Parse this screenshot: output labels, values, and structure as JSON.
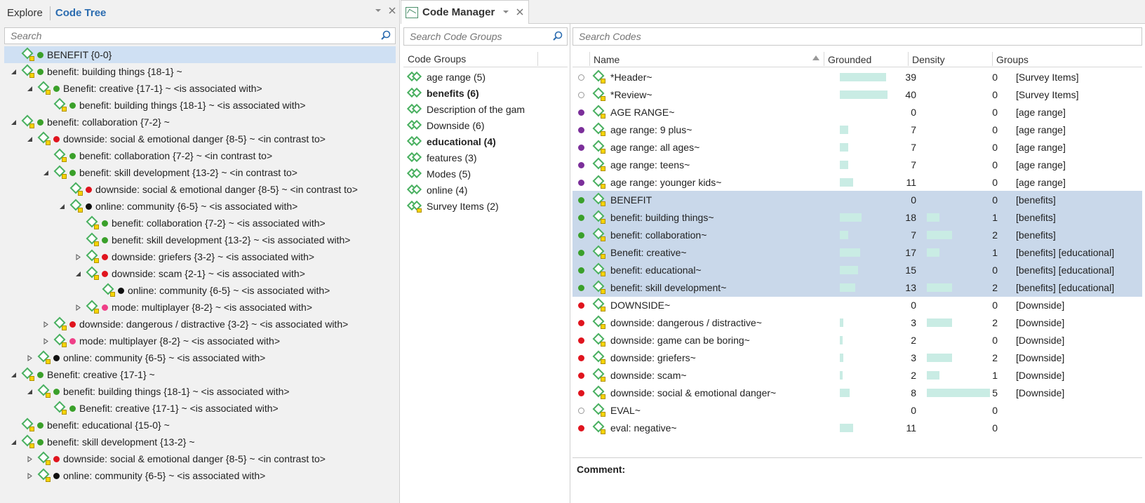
{
  "left_panel": {
    "tab_explore": "Explore",
    "tab_code_tree": "Code Tree",
    "search_placeholder": "Search",
    "tree": [
      {
        "label": "BENEFIT {0-0}",
        "dot": "green",
        "twisty": "",
        "indent": 0,
        "selected": true
      },
      {
        "label": "benefit: building things {18-1} ~",
        "dot": "green",
        "twisty": "open",
        "indent": 0
      },
      {
        "label": "Benefit: creative {17-1} ~ <is associated with>",
        "dot": "green",
        "twisty": "open",
        "indent": 1
      },
      {
        "label": "benefit: building things {18-1} ~ <is associated with>",
        "dot": "green",
        "twisty": "",
        "indent": 2
      },
      {
        "label": "benefit: collaboration {7-2} ~",
        "dot": "green",
        "twisty": "open",
        "indent": 0
      },
      {
        "label": "downside: social & emotional danger {8-5} ~ <in contrast to>",
        "dot": "red",
        "twisty": "open",
        "indent": 1
      },
      {
        "label": "benefit: collaboration {7-2} ~ <in contrast to>",
        "dot": "green",
        "twisty": "",
        "indent": 2
      },
      {
        "label": "benefit: skill development {13-2} ~ <in contrast to>",
        "dot": "green",
        "twisty": "open",
        "indent": 2
      },
      {
        "label": "downside: social & emotional danger {8-5} ~ <in contrast to>",
        "dot": "red",
        "twisty": "",
        "indent": 3
      },
      {
        "label": "online: community {6-5} ~ <is associated with>",
        "dot": "black",
        "twisty": "open",
        "indent": 3
      },
      {
        "label": "benefit: collaboration {7-2} ~ <is associated with>",
        "dot": "green",
        "twisty": "",
        "indent": 4
      },
      {
        "label": "benefit: skill development {13-2} ~ <is associated with>",
        "dot": "green",
        "twisty": "",
        "indent": 4
      },
      {
        "label": "downside: griefers {3-2} ~ <is associated with>",
        "dot": "red",
        "twisty": "closed",
        "indent": 4
      },
      {
        "label": "downside: scam {2-1} ~ <is associated with>",
        "dot": "red",
        "twisty": "open",
        "indent": 4
      },
      {
        "label": "online: community {6-5} ~ <is associated with>",
        "dot": "black",
        "twisty": "",
        "indent": 5
      },
      {
        "label": "mode: multiplayer {8-2} ~ <is associated with>",
        "dot": "pink",
        "twisty": "closed",
        "indent": 4
      },
      {
        "label": "downside: dangerous / distractive {3-2} ~ <is associated with>",
        "dot": "red",
        "twisty": "closed",
        "indent": 2
      },
      {
        "label": "mode: multiplayer {8-2} ~ <is associated with>",
        "dot": "pink",
        "twisty": "closed",
        "indent": 2
      },
      {
        "label": "online: community {6-5} ~ <is associated with>",
        "dot": "black",
        "twisty": "closed",
        "indent": 1
      },
      {
        "label": "Benefit: creative {17-1} ~",
        "dot": "green",
        "twisty": "open",
        "indent": 0
      },
      {
        "label": "benefit: building things {18-1} ~ <is associated with>",
        "dot": "green",
        "twisty": "open",
        "indent": 1
      },
      {
        "label": "Benefit: creative {17-1} ~ <is associated with>",
        "dot": "green",
        "twisty": "",
        "indent": 2
      },
      {
        "label": "benefit: educational {15-0} ~",
        "dot": "green",
        "twisty": "",
        "indent": 0
      },
      {
        "label": "benefit: skill development {13-2} ~",
        "dot": "green",
        "twisty": "open",
        "indent": 0
      },
      {
        "label": "downside: social & emotional danger {8-5} ~ <in contrast to>",
        "dot": "red",
        "twisty": "closed",
        "indent": 1
      },
      {
        "label": "online: community {6-5} ~ <is associated with>",
        "dot": "black",
        "twisty": "closed",
        "indent": 1
      }
    ]
  },
  "code_manager": {
    "title": "Code Manager",
    "groups_search_placeholder": "Search Code Groups",
    "codes_search_placeholder": "Search Codes",
    "groups_header": "Code Groups",
    "groups": [
      {
        "label": "age range (5)",
        "bold": false
      },
      {
        "label": "benefits (6)",
        "bold": true
      },
      {
        "label": "Description of the gam",
        "bold": false
      },
      {
        "label": "Downside (6)",
        "bold": false
      },
      {
        "label": "educational (4)",
        "bold": true
      },
      {
        "label": "features (3)",
        "bold": false
      },
      {
        "label": "Modes (5)",
        "bold": false
      },
      {
        "label": "online (4)",
        "bold": false
      },
      {
        "label": "Survey Items (2)",
        "bold": false
      }
    ],
    "columns": {
      "name": "Name",
      "grounded": "Grounded",
      "density": "Density",
      "groups": "Groups"
    },
    "colors": {
      "green": "#3aa02a",
      "red": "#e0141e",
      "purple": "#7b2f9a",
      "bar": "#c9ece4",
      "selected": "#c9d8ea"
    },
    "codes": [
      {
        "dot": "empty",
        "name": "*Header~",
        "grounded": 39,
        "density": 0,
        "groups": "[Survey Items]",
        "selected": false
      },
      {
        "dot": "empty",
        "name": "*Review~",
        "grounded": 40,
        "density": 0,
        "groups": "[Survey Items]",
        "selected": false
      },
      {
        "dot": "purple",
        "name": "AGE RANGE~",
        "grounded": 0,
        "density": 0,
        "groups": "[age range]",
        "selected": false
      },
      {
        "dot": "purple",
        "name": "age range: 9 plus~",
        "grounded": 7,
        "density": 0,
        "groups": "[age range]",
        "selected": false
      },
      {
        "dot": "purple",
        "name": "age range: all ages~",
        "grounded": 7,
        "density": 0,
        "groups": "[age range]",
        "selected": false
      },
      {
        "dot": "purple",
        "name": "age range: teens~",
        "grounded": 7,
        "density": 0,
        "groups": "[age range]",
        "selected": false
      },
      {
        "dot": "purple",
        "name": "age range: younger kids~",
        "grounded": 11,
        "density": 0,
        "groups": "[age range]",
        "selected": false
      },
      {
        "dot": "green",
        "name": "BENEFIT",
        "grounded": 0,
        "density": 0,
        "groups": "[benefits]",
        "selected": true
      },
      {
        "dot": "green",
        "name": "benefit: building things~",
        "grounded": 18,
        "density": 1,
        "groups": "[benefits]",
        "selected": true
      },
      {
        "dot": "green",
        "name": "benefit: collaboration~",
        "grounded": 7,
        "density": 2,
        "groups": "[benefits]",
        "selected": true
      },
      {
        "dot": "green",
        "name": "Benefit: creative~",
        "grounded": 17,
        "density": 1,
        "groups": "[benefits] [educational]",
        "selected": true
      },
      {
        "dot": "green",
        "name": "benefit: educational~",
        "grounded": 15,
        "density": 0,
        "groups": "[benefits] [educational]",
        "selected": true
      },
      {
        "dot": "green",
        "name": "benefit: skill development~",
        "grounded": 13,
        "density": 2,
        "groups": "[benefits] [educational]",
        "selected": true
      },
      {
        "dot": "red",
        "name": "DOWNSIDE~",
        "grounded": 0,
        "density": 0,
        "groups": "[Downside]",
        "selected": false
      },
      {
        "dot": "red",
        "name": "downside: dangerous / distractive~",
        "grounded": 3,
        "density": 2,
        "groups": "[Downside]",
        "selected": false
      },
      {
        "dot": "red",
        "name": "downside: game can be boring~",
        "grounded": 2,
        "density": 0,
        "groups": "[Downside]",
        "selected": false
      },
      {
        "dot": "red",
        "name": "downside: griefers~",
        "grounded": 3,
        "density": 2,
        "groups": "[Downside]",
        "selected": false
      },
      {
        "dot": "red",
        "name": "downside: scam~",
        "grounded": 2,
        "density": 1,
        "groups": "[Downside]",
        "selected": false
      },
      {
        "dot": "red",
        "name": "downside: social & emotional danger~",
        "grounded": 8,
        "density": 5,
        "groups": "[Downside]",
        "selected": false
      },
      {
        "dot": "empty",
        "name": "EVAL~",
        "grounded": 0,
        "density": 0,
        "groups": "",
        "selected": false
      },
      {
        "dot": "red",
        "name": "eval: negative~",
        "grounded": 11,
        "density": 0,
        "groups": "",
        "selected": false
      }
    ],
    "comment_label": "Comment:"
  }
}
